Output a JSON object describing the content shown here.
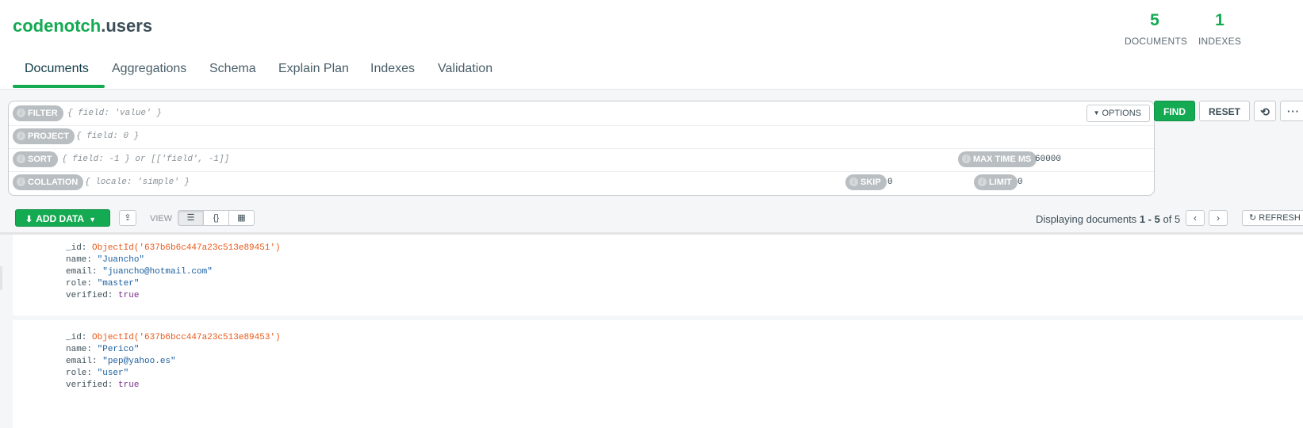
{
  "header": {
    "db_name": "codenotch",
    "collection_name": ".users",
    "stats": [
      {
        "value": "5",
        "label": "DOCUMENTS"
      },
      {
        "value": "1",
        "label": "INDEXES"
      }
    ]
  },
  "tabs": [
    {
      "label": "Documents",
      "active": true
    },
    {
      "label": "Aggregations"
    },
    {
      "label": "Schema"
    },
    {
      "label": "Explain Plan"
    },
    {
      "label": "Indexes"
    },
    {
      "label": "Validation"
    }
  ],
  "query": {
    "filter": {
      "label": "FILTER",
      "placeholder": "{ field: 'value' }"
    },
    "project": {
      "label": "PROJECT",
      "placeholder": "{ field: 0 }"
    },
    "sort": {
      "label": "SORT",
      "placeholder": "{ field: -1 } or [['field', -1]]"
    },
    "collation": {
      "label": "COLLATION",
      "placeholder": "{ locale: 'simple' }"
    },
    "max_time_ms": {
      "label": "MAX TIME MS",
      "value": "60000"
    },
    "skip": {
      "label": "SKIP",
      "value": "0"
    },
    "limit": {
      "label": "LIMIT",
      "value": "0"
    },
    "options_label": "OPTIONS",
    "find_label": "FIND",
    "reset_label": "RESET",
    "info_glyph": "i"
  },
  "toolbar": {
    "add_data_label": "ADD DATA",
    "view_label": "VIEW",
    "displaying_prefix": "Displaying documents",
    "range_start": "1",
    "range_sep": " - ",
    "range_end": "5",
    "of_label": "of",
    "total": "5",
    "refresh_label": "REFRESH"
  },
  "documents": [
    {
      "id_key": "_id:",
      "id_value": "ObjectId('637b6b6c447a23c513e89451')",
      "name_key": "name:",
      "name_value": "\"Juancho\"",
      "email_key": "email:",
      "email_value": "\"juancho@hotmail.com\"",
      "role_key": "role:",
      "role_value": "\"master\"",
      "verified_key": "verified:",
      "verified_value": "true"
    },
    {
      "id_key": "_id:",
      "id_value": "ObjectId('637b6bcc447a23c513e89453')",
      "name_key": "name:",
      "name_value": "\"Perico\"",
      "email_key": "email:",
      "email_value": "\"pep@yahoo.es\"",
      "role_key": "role:",
      "role_value": "\"user\"",
      "verified_key": "verified:",
      "verified_value": "true"
    }
  ],
  "colors": {
    "brand_green": "#13aa52",
    "objectid": "#e8591a",
    "string": "#1a5e9e",
    "boolean": "#7b2d8e"
  },
  "icons": {
    "download": "download-icon",
    "export": "export-icon",
    "list_view": "list-view-icon",
    "json_view": "json-view-icon",
    "table_view": "table-view-icon",
    "history": "history-icon",
    "more": "more-icon",
    "prev": "chevron-left-icon",
    "next": "chevron-right-icon",
    "refresh": "refresh-icon"
  }
}
